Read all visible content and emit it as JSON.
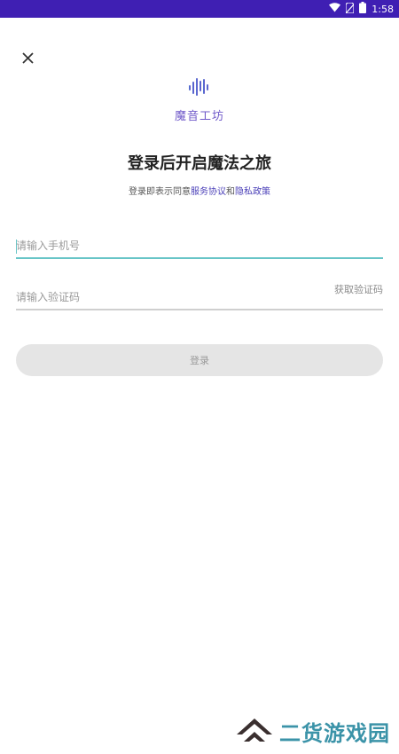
{
  "status_bar": {
    "time": "1:58",
    "bg_color": "#3f1fb3",
    "icons": [
      "wifi-icon",
      "no-sim-icon",
      "battery-icon"
    ]
  },
  "header": {
    "close_icon": "close-icon",
    "logo_icon": "sound-wave-icon",
    "app_name": "魔音工坊"
  },
  "login": {
    "title": "登录后开启魔法之旅",
    "agreement_prefix": "登录即表示同意",
    "service_link": "服务协议",
    "agreement_and": "和",
    "privacy_link": "隐私政策",
    "phone_placeholder": "请输入手机号",
    "phone_value": "",
    "code_placeholder": "请输入验证码",
    "code_value": "",
    "get_code_label": "获取验证码",
    "login_label": "登录"
  },
  "watermark": {
    "text": "二货游戏园"
  },
  "colors": {
    "accent": "#67c5c7",
    "link": "#4a3fb8",
    "brand": "#6f58c9",
    "button_disabled": "#e5e5e5"
  }
}
